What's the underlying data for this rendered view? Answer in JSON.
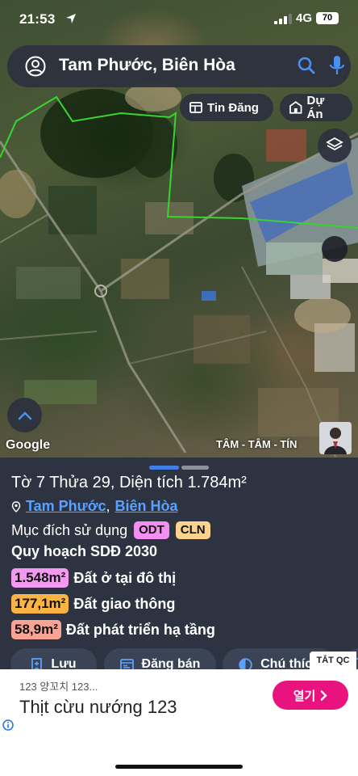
{
  "status_bar": {
    "time": "21:53",
    "network": "4G",
    "battery": "70"
  },
  "search": {
    "query": "Tam Phước, Biên Hòa"
  },
  "map_chips": {
    "news": "Tin Đăng",
    "project": "Dự Án"
  },
  "map": {
    "attribution": "Google",
    "watermark": "TÂM - TÂM - TÍN"
  },
  "parcel": {
    "title": "Tờ 7 Thửa 29, Diện tích 1.784m²",
    "ward": "Tam Phước",
    "separator": ",",
    "city": "Biên Hòa",
    "purpose_label": "Mục đích sử dụng",
    "purpose_tags": [
      "ODT",
      "CLN"
    ],
    "plan_title": "Quy hoạch SDĐ 2030",
    "land_uses": [
      {
        "area": "1.548m²",
        "desc": "Đất ở tại đô thị",
        "color": "#f39af0"
      },
      {
        "area": "177,1m²",
        "desc": "Đất giao thông",
        "color": "#fbb444"
      },
      {
        "area": "58,9m²",
        "desc": "Đất phát triển hạ tầng",
        "color": "#f8a394"
      }
    ]
  },
  "actions": {
    "save": "Lưu",
    "post": "Đăng bán",
    "legend": "Chú thích"
  },
  "ad": {
    "close_label": "TẮT QC",
    "subtitle": "123 양꼬치 123...",
    "title": "Thịt cừu nướng 123",
    "cta": "열기"
  },
  "colors": {
    "sheet_bg": "#2d3340",
    "button_bg": "#3b4456",
    "link": "#5aa1ff",
    "ad_cta": "#e8137f"
  }
}
